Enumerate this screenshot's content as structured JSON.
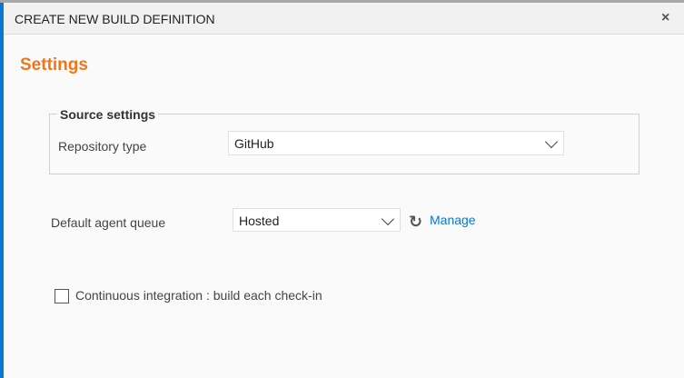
{
  "dialog": {
    "title": "CREATE NEW BUILD DEFINITION",
    "close_label": "×"
  },
  "section_title": "Settings",
  "source_settings": {
    "legend": "Source settings",
    "repository_type_label": "Repository type",
    "repository_type_value": "GitHub"
  },
  "agent_queue": {
    "label": "Default agent queue",
    "value": "Hosted",
    "manage_label": "Manage"
  },
  "ci": {
    "label": "Continuous integration : build each check-in",
    "checked": false
  }
}
